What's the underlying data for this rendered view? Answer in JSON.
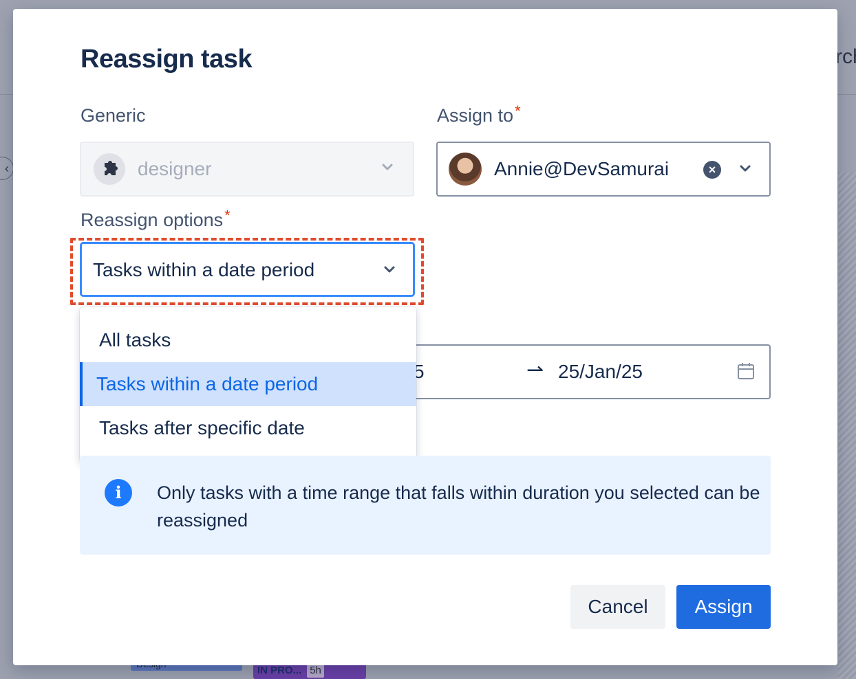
{
  "background": {
    "search_fragment": "rch",
    "bar_label": "Design",
    "badge_status": "IN PRO...",
    "badge_hours": "5h"
  },
  "modal": {
    "title": "Reassign task",
    "generic": {
      "label": "Generic",
      "value": "designer",
      "icon": "puzzle-icon"
    },
    "assign_to": {
      "label": "Assign to",
      "required_mark": "*",
      "value": "Annie@DevSamurai"
    },
    "reassign_options": {
      "label": "Reassign options",
      "required_mark": "*",
      "value": "Tasks within a date period",
      "options": [
        "All tasks",
        "Tasks within a date period",
        "Tasks after specific date"
      ],
      "selected_index": 1
    },
    "date_range": {
      "start_visible": "5",
      "arrow": "⇀",
      "end": "25/Jan/25"
    },
    "info": {
      "text": "Only tasks with a time range that falls within duration you selected can be reassigned"
    },
    "buttons": {
      "cancel": "Cancel",
      "assign": "Assign"
    }
  },
  "colors": {
    "primary": "#1f6ce0",
    "focus_highlight": "#e04b2e",
    "info_bg": "#e9f2ff",
    "selected_option_bg": "#cfe1fd",
    "required": "#de350b"
  }
}
